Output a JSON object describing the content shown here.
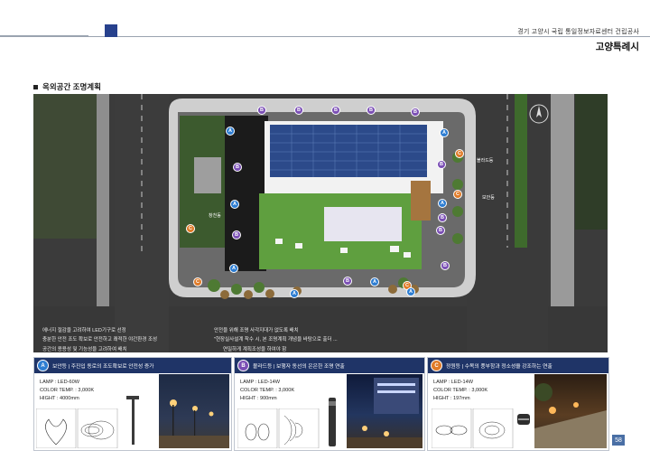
{
  "header": {
    "project": "경기 고양시 국립 통일정보자료센터 건립공사",
    "city": "고양특례시"
  },
  "section": {
    "title": "옥외공간 조명계획"
  },
  "plan_labels": {
    "left_building": "창천동",
    "right_top": "볼라드등",
    "right_mid": "보안등"
  },
  "notes": [
    "에너지 절감을 고려하여 LED기구로 선정",
    "충분한 안전 조도 확보로 안전하고 쾌적한 야간환경 조성",
    "공간의 용용성 및 기능성을 고려하여 배치",
    "안전을 위해 조명 사각지대가 없도록 배치",
    "\"현장실사설계 착수 시, 본 조명계획 개념을 바탕으로 출더 ...",
    "연밀하게 계획조성을 하여야 함"
  ],
  "panels": [
    {
      "badge": "A",
      "badge_color": "#2d7dd2",
      "title": "보안등 | 주진입 동로의 조도확보로 안전성 증가",
      "specs": [
        "LAMP : LED-60W",
        "COLOR TEMP. : 3,000K",
        "HIGHT : 4000mm"
      ]
    },
    {
      "badge": "B",
      "badge_color": "#7b4fb5",
      "title": "볼라드등 | 보행자 동선의 은은한 조명 연출",
      "specs": [
        "LAMP : LED-14W",
        "COLOR TEMP. : 3,000K",
        "HIGHT : 900mm"
      ]
    },
    {
      "badge": "C",
      "badge_color": "#e07b28",
      "title": "정원등 | 수목의 풍부함과 정소성을 강조하는 연출",
      "specs": [
        "LAMP : LED-14W",
        "COLOR TEMP. : 3,000K",
        "HIGHT : 197mm"
      ]
    }
  ],
  "page_number": "58"
}
